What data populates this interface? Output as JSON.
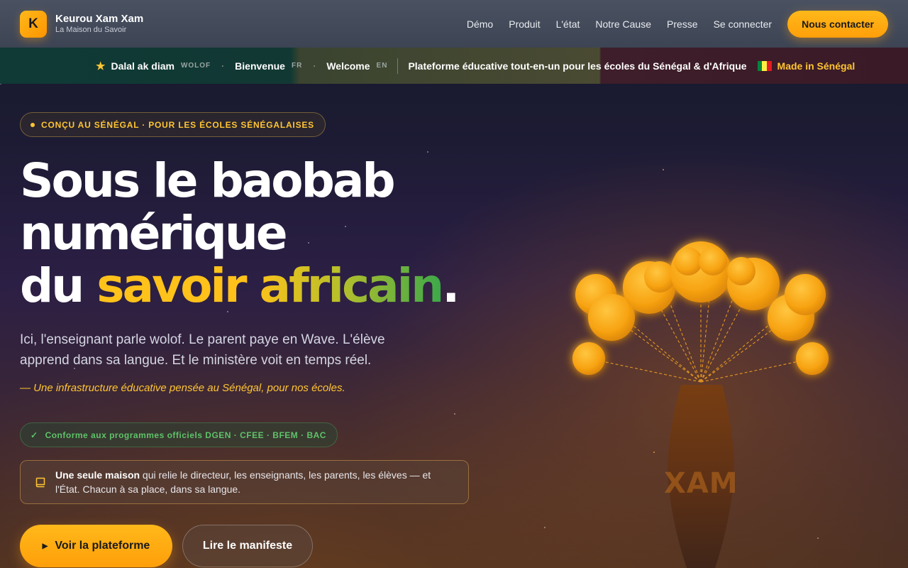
{
  "header": {
    "logo_letter": "K",
    "brand_name": "Keurou Xam Xam",
    "brand_tagline": "La Maison du Savoir",
    "nav": [
      "Démo",
      "Produit",
      "L'état",
      "Notre Cause",
      "Presse",
      "Se connecter"
    ],
    "cta": "Nous contacter"
  },
  "strip": {
    "greetings": [
      {
        "text": "Dalal ak diam",
        "lang": "WOLOF"
      },
      {
        "text": "Bienvenue",
        "lang": "FR"
      },
      {
        "text": "Welcome",
        "lang": "EN"
      }
    ],
    "tagline": "Plateforme éducative tout-en-un pour les écoles du Sénégal & d'Afrique",
    "made_in": "Made in Sénégal",
    "flag_colors": [
      "#00853f",
      "#fdef42",
      "#e31b23"
    ]
  },
  "hero": {
    "badge": "CONÇU AU SÉNÉGAL · POUR LES ÉCOLES SÉNÉGALAISES",
    "title_line1": "Sous le baobab",
    "title_line2": "numérique",
    "title_line3_prefix": "du ",
    "title_line3_highlight": "savoir africain",
    "title_line3_suffix": ".",
    "lead": "Ici, l'enseignant parle wolof. Le parent paye en Wave. L'élève apprend dans sa langue. Et le ministère voit en temps réel.",
    "quote": "— Une infrastructure éducative pensée au Sénégal, pour nos écoles.",
    "conformity": "Conforme aux programmes officiels DGEN · CFEE · BFEM · BAC",
    "maison_bold": "Une seule maison",
    "maison_rest": " qui relie le directeur, les enseignants, les parents, les élèves — et l'État. Chacun à sa place, dans sa langue.",
    "btn_primary": "Voir la plateforme",
    "btn_secondary": "Lire le manifeste",
    "illustration_label": "XAM"
  },
  "colors": {
    "accent": "#ffb81a",
    "gold_text": "#ffc533",
    "green": "#5fc26a"
  }
}
